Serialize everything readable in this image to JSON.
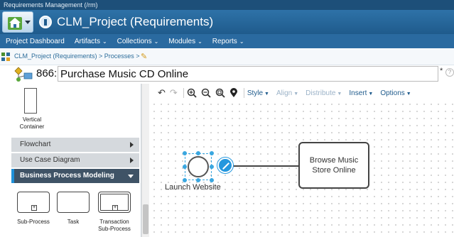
{
  "window": {
    "title": "Requirements Management (/rm)"
  },
  "header": {
    "project_title": "CLM_Project (Requirements)"
  },
  "nav": {
    "items": [
      {
        "label": "Project Dashboard",
        "dropdown": false
      },
      {
        "label": "Artifacts",
        "dropdown": true
      },
      {
        "label": "Collections",
        "dropdown": true
      },
      {
        "label": "Modules",
        "dropdown": true
      },
      {
        "label": "Reports",
        "dropdown": true
      }
    ]
  },
  "breadcrumb": {
    "text": "CLM_Project (Requirements) > Processes >"
  },
  "artifact": {
    "id": "866:",
    "name": "Purchase Music CD Online",
    "dirty_marker": "*",
    "help": "?"
  },
  "palette": {
    "container_label_1": "Vertical",
    "container_label_2": "Container",
    "categories": [
      {
        "label": "Flowchart",
        "active": false
      },
      {
        "label": "Use Case Diagram",
        "active": false
      },
      {
        "label": "Business Process Modeling",
        "active": true
      }
    ],
    "shapes": [
      {
        "label": "Sub-Process"
      },
      {
        "label": "Task"
      },
      {
        "label": "Transaction Sub-Process"
      }
    ]
  },
  "toolbar": {
    "menus": [
      {
        "label": "Style",
        "enabled": true
      },
      {
        "label": "Align",
        "enabled": false
      },
      {
        "label": "Distribute",
        "enabled": false
      },
      {
        "label": "Insert",
        "enabled": true
      },
      {
        "label": "Options",
        "enabled": true
      }
    ]
  },
  "diagram": {
    "start_event_label": "Launch Website",
    "task_label": "Browse Music Store Online"
  },
  "colors": {
    "nav_bg": "#2a6aa0",
    "title_bg": "#1f5b8c",
    "accent": "#2497de",
    "active_category": "#3f5366"
  }
}
